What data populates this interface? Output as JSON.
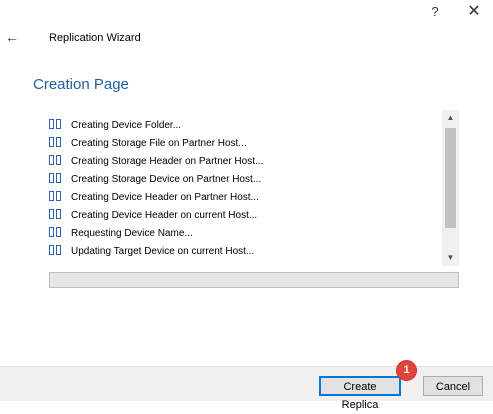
{
  "window": {
    "title": "Replication Wizard",
    "help_label": "?",
    "close_label": "✕",
    "back_label": "←"
  },
  "page": {
    "title": "Creation Page"
  },
  "log": {
    "items": [
      {
        "text": "Creating Device Folder..."
      },
      {
        "text": "Creating Storage File on Partner Host..."
      },
      {
        "text": "Creating Storage Header on Partner Host..."
      },
      {
        "text": "Creating Storage Device on Partner Host..."
      },
      {
        "text": "Creating Device Header on Partner Host..."
      },
      {
        "text": "Creating Device Header on current Host..."
      },
      {
        "text": "Requesting Device Name..."
      },
      {
        "text": "Updating Target Device on current Host..."
      }
    ],
    "scroll_up_icon": "▲",
    "scroll_down_icon": "▼"
  },
  "progress": {
    "fraction": 0
  },
  "buttons": {
    "create_label": "Create Replica",
    "cancel_label": "Cancel"
  },
  "annotation": {
    "badge_number": "1",
    "badge_color": "#e0443a"
  },
  "colors": {
    "accent": "#1f5fa8",
    "icon": "#2b63b5"
  }
}
